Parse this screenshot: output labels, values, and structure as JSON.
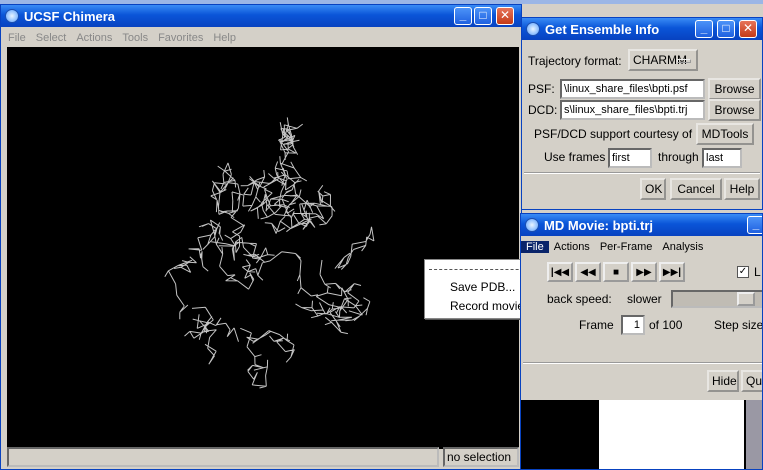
{
  "chimera": {
    "title": "UCSF Chimera",
    "menu": [
      "File",
      "Select",
      "Actions",
      "Tools",
      "Favorites",
      "Help"
    ],
    "status": "no selection",
    "viewport_bg": "#000000"
  },
  "file_menu": {
    "items": [
      "Save PDB...",
      "Record movie..."
    ]
  },
  "ensemble": {
    "title": "Get Ensemble Info",
    "traj_label": "Trajectory format:",
    "traj_value": "CHARMM",
    "psf_label": "PSF:",
    "psf_value": "\\linux_share_files\\bpti.psf",
    "dcd_label": "DCD:",
    "dcd_value": "s\\linux_share_files\\bpti.trj",
    "browse": "Browse",
    "courtesy": "PSF/DCD support courtesy of",
    "mdtools": "MDTools",
    "use_frames": "Use frames",
    "first": "first",
    "through": "through",
    "last": "last",
    "ok": "OK",
    "cancel": "Cancel",
    "help": "Help"
  },
  "md_movie": {
    "title": "MD Movie: bpti.trj",
    "menu": [
      "File",
      "Actions",
      "Per-Frame",
      "Analysis"
    ],
    "loop_label": "L",
    "speed_label": "back speed:",
    "speed_value": "slower",
    "frame_label": "Frame",
    "frame_value": "1",
    "frame_of": "of 100",
    "step_label": "Step size",
    "hide": "Hide",
    "quit": "Qu"
  },
  "colors": {
    "accent": "#0a55d8",
    "menu_selected": "#0a246a"
  }
}
